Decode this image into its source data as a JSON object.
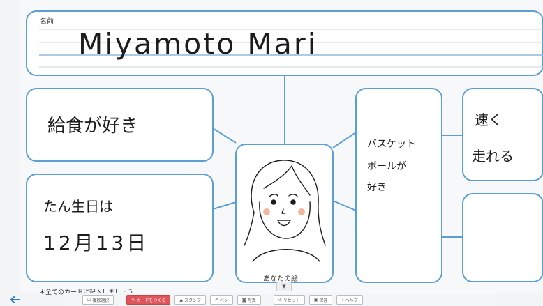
{
  "worksheet": {
    "name_label": "名前",
    "name_value": "Miyamoto Mari",
    "portrait_caption": "あなたの絵",
    "cards": {
      "top_left": "給食が好き",
      "bottom_left_line1": "たん生日は",
      "bottom_left_line2": "12月13日",
      "middle_right_line1": "バスケット",
      "middle_right_line2": "ボールが",
      "middle_right_line3": "好き",
      "far_right_top_line1": "速く",
      "far_right_top_line2": "走れる",
      "far_right_bottom": ""
    },
    "note": "＊全てのカードに記入しましょう"
  },
  "toolbar": {
    "items": [
      {
        "label": "複数選択",
        "icon": "checkbox-icon"
      },
      {
        "label": "カードをつくる",
        "icon": "pencil-card-icon",
        "active": true
      },
      {
        "label": "スタンプ",
        "icon": "stamp-icon"
      },
      {
        "label": "ペン",
        "icon": "pen-icon"
      },
      {
        "label": "写真",
        "icon": "camera-icon"
      },
      {
        "label": "リセット",
        "icon": "reset-icon"
      },
      {
        "label": "保存",
        "icon": "save-icon"
      },
      {
        "label": "ヘルプ",
        "icon": "help-icon"
      }
    ]
  },
  "colors": {
    "card_border": "#5b9fd6",
    "connector": "#5b9fd6",
    "ruled_line": "#c9d5e0",
    "accent_line": "#8fb8dd",
    "toolbar_active": "#e0545a",
    "cheek": "#f2a98a",
    "back_button": "#2f78c4"
  }
}
